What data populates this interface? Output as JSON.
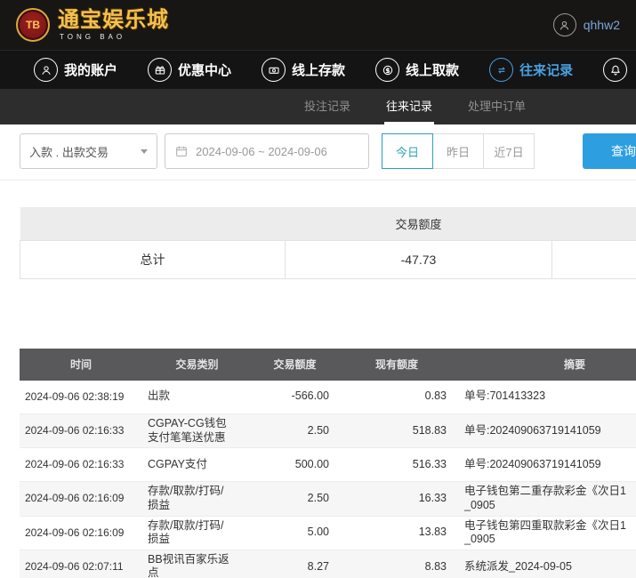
{
  "brand": {
    "badge": "TB",
    "title": "通宝娱乐城",
    "subtitle": "TONG BAO"
  },
  "user": {
    "name": "qhhw2"
  },
  "nav": {
    "items": [
      {
        "label": "我的账户",
        "icon": "user-icon"
      },
      {
        "label": "优惠中心",
        "icon": "gift-icon"
      },
      {
        "label": "线上存款",
        "icon": "deposit-icon"
      },
      {
        "label": "线上取款",
        "icon": "withdraw-icon"
      },
      {
        "label": "往来记录",
        "icon": "records-icon",
        "active": true
      },
      {
        "label": "",
        "icon": "bell-icon"
      }
    ]
  },
  "tabs": {
    "items": [
      {
        "label": "投注记录",
        "active": false
      },
      {
        "label": "往来记录",
        "active": true
      },
      {
        "label": "处理中订单",
        "active": false
      }
    ]
  },
  "filters": {
    "type_select": "入款 . 出款交易",
    "date_range": "2024-09-06 ~ 2024-09-06",
    "today": "今日",
    "yesterday": "昨日",
    "last7": "近7日",
    "search": "查询"
  },
  "summary": {
    "header": "交易额度",
    "total_label": "总计",
    "total_value": "-47.73"
  },
  "table": {
    "headers": [
      "时间",
      "交易类别",
      "交易额度",
      "现有额度",
      "摘要"
    ],
    "rows": [
      {
        "time": "2024-09-06 02:38:19",
        "type": "出款",
        "amount": "-566.00",
        "balance": "0.83",
        "note": "单号:701413323"
      },
      {
        "time": "2024-09-06 02:16:33",
        "type": "CGPAY-CG钱包\n支付笔笔送优惠",
        "amount": "2.50",
        "balance": "518.83",
        "note": "单号:202409063719141059"
      },
      {
        "time": "2024-09-06 02:16:33",
        "type": "CGPAY支付",
        "amount": "500.00",
        "balance": "516.33",
        "note": "单号:202409063719141059"
      },
      {
        "time": "2024-09-06 02:16:09",
        "type": "存款/取款/打码/\n损益",
        "amount": "2.50",
        "balance": "16.33",
        "note": "电子钱包第二重存款彩金《次日1\n_0905"
      },
      {
        "time": "2024-09-06 02:16:09",
        "type": "存款/取款/打码/\n损益",
        "amount": "5.00",
        "balance": "13.83",
        "note": "电子钱包第四重取款彩金《次日1\n_0905"
      },
      {
        "time": "2024-09-06 02:07:11",
        "type": "BB视讯百家乐返\n点",
        "amount": "8.27",
        "balance": "8.83",
        "note": "系统派发_2024-09-05"
      }
    ]
  },
  "colors": {
    "accent_blue": "#4aa0e2",
    "teal_active": "#2aa3b8",
    "search_button": "#2d9fe0",
    "brand_gold": "#f3c14d",
    "table_header_bg": "#59595c"
  }
}
